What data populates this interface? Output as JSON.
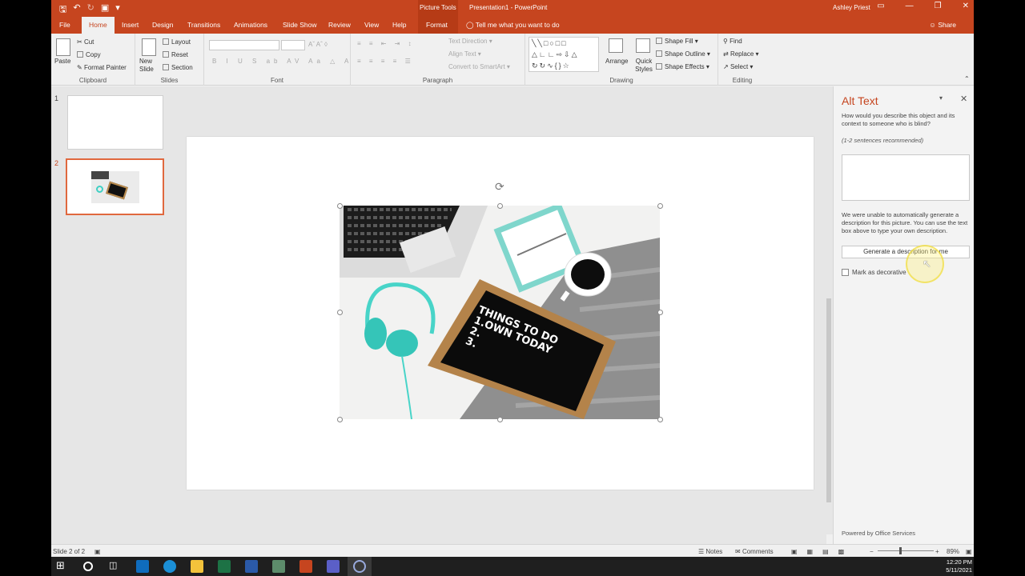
{
  "window": {
    "context_label": "Picture Tools",
    "doc_title": "Presentation1 - PowerPoint",
    "user": "Ashley Priest"
  },
  "tabs": {
    "file": "File",
    "home": "Home",
    "insert": "Insert",
    "design": "Design",
    "transitions": "Transitions",
    "animations": "Animations",
    "slideshow": "Slide Show",
    "review": "Review",
    "view": "View",
    "help": "Help",
    "format": "Format",
    "tell_me": "Tell me what you want to do",
    "share": "Share"
  },
  "ribbon": {
    "clipboard": {
      "label": "Clipboard",
      "paste": "Paste",
      "cut": "Cut",
      "copy": "Copy",
      "format_painter": "Format Painter"
    },
    "slides": {
      "label": "Slides",
      "new_slide": "New Slide",
      "layout": "Layout",
      "reset": "Reset",
      "section": "Section"
    },
    "font": {
      "label": "Font"
    },
    "paragraph": {
      "label": "Paragraph",
      "text_direction": "Text Direction",
      "align_text": "Align Text",
      "convert_smartart": "Convert to SmartArt"
    },
    "drawing": {
      "label": "Drawing",
      "arrange": "Arrange",
      "quick_styles": "Quick Styles",
      "shape_fill": "Shape Fill",
      "shape_outline": "Shape Outline",
      "shape_effects": "Shape Effects"
    },
    "editing": {
      "label": "Editing",
      "find": "Find",
      "replace": "Replace",
      "select": "Select"
    }
  },
  "thumbnails": [
    {
      "num": "1"
    },
    {
      "num": "2"
    }
  ],
  "picture": {
    "chalkboard_lines": [
      "THINGS TO DO",
      "1.OWN TODAY",
      "2.",
      "3."
    ]
  },
  "alt_text": {
    "title": "Alt Text",
    "question": "How would you describe this object and its context to someone who is blind?",
    "hint": "(1-2 sentences recommended)",
    "value": "",
    "note": "We were unable to automatically generate a description for this picture. You can use the text box above to type your own description.",
    "generate_button": "Generate a description for me",
    "mark_decorative": "Mark as decorative",
    "powered_by": "Powered by Office Services"
  },
  "status": {
    "slide_count": "Slide 2 of 2",
    "notes": "Notes",
    "comments": "Comments",
    "zoom": "89%"
  },
  "taskbar": {
    "time": "12:20 PM",
    "date": "5/11/2021"
  },
  "colors": {
    "accent": "#c6451f",
    "selected_thumb": "#e0683e"
  }
}
